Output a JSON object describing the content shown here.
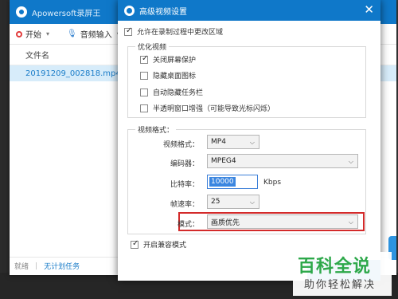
{
  "app": {
    "title": "Apowersoft录屏王",
    "toolbar": {
      "start_label": "开始",
      "audio_label": "音频输入"
    },
    "file_list": {
      "column_header": "文件名",
      "rows": [
        "20191209_002818.mp4"
      ]
    },
    "status": {
      "left": "就绪",
      "separator": "|",
      "link": "无计划任务"
    }
  },
  "dialog": {
    "title": "高级视频设置",
    "allow_change_region": {
      "label": "允许在录制过程中更改区域",
      "checked": true
    },
    "optimize_group": {
      "label": "优化视频",
      "options": [
        {
          "label": "关闭屏幕保护",
          "checked": true
        },
        {
          "label": "隐藏桌面图标",
          "checked": false
        },
        {
          "label": "自动隐藏任务栏",
          "checked": false
        },
        {
          "label": "半透明窗口增强（可能导致光标闪烁）",
          "checked": false
        }
      ]
    },
    "format_group": {
      "label": "视频格式：",
      "video_format": {
        "label": "视频格式：",
        "value": "MP4"
      },
      "encoder": {
        "label": "编码器：",
        "value": "MPEG4"
      },
      "bitrate": {
        "label": "比特率：",
        "value": "10000",
        "unit": "Kbps"
      },
      "framerate": {
        "label": "帧速率：",
        "value": "25"
      },
      "mode": {
        "label": "模式：",
        "value": "画质优先"
      }
    },
    "compat_mode": {
      "label": "开启兼容模式",
      "checked": true
    }
  },
  "watermark": {
    "top": "百科全说",
    "bottom": "助你轻松解决"
  },
  "colors": {
    "accent": "#0f78c9",
    "highlight": "#d32a2a",
    "watermark_green": "#2da84a"
  }
}
